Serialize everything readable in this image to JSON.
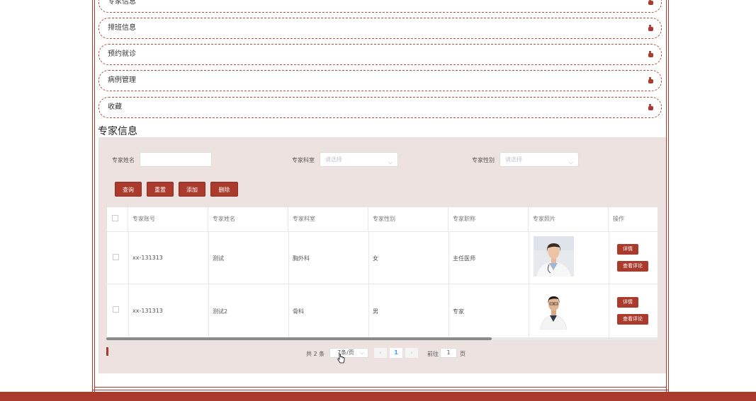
{
  "menu": {
    "items": [
      {
        "label": "专家信息"
      },
      {
        "label": "排班信息"
      },
      {
        "label": "预约就诊"
      },
      {
        "label": "病例管理"
      },
      {
        "label": "收藏"
      }
    ]
  },
  "section": {
    "title": "专家信息"
  },
  "filters": {
    "name_label": "专家姓名",
    "name_value": "",
    "dept_label": "专家科室",
    "dept_placeholder": "请选择",
    "gender_label": "专家性别",
    "gender_placeholder": "请选择"
  },
  "actions": {
    "query": "查询",
    "reset": "重置",
    "add": "添加",
    "delete": "删除"
  },
  "table": {
    "headers": [
      "专家账号",
      "专家姓名",
      "专家科室",
      "专家性别",
      "专家职称",
      "专家照片",
      "操作"
    ],
    "rows": [
      {
        "account": "xx-131313",
        "name": "测试",
        "dept": "胸外科",
        "gender": "女",
        "title": "主任医师",
        "detail": "详情",
        "review": "查看评论"
      },
      {
        "account": "xx-131313",
        "name": "测试2",
        "dept": "骨科",
        "gender": "男",
        "title": "专家",
        "detail": "详情",
        "review": "查看评论"
      }
    ]
  },
  "pagination": {
    "total": "共 2 条",
    "page_size": "7条/页",
    "prev": "‹",
    "current": "1",
    "next": "›",
    "goto_label": "前往",
    "goto_value": "1",
    "page_suffix": "页"
  },
  "colors": {
    "accent": "#a93a2c",
    "panel": "#ede2e0"
  }
}
